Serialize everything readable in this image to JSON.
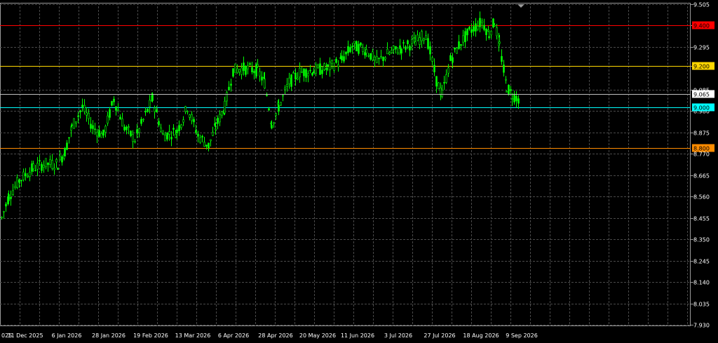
{
  "window": {
    "scroll_marker_icon": "triangle-down-icon"
  },
  "chart_data": {
    "type": "candlestick",
    "grid": true,
    "background": "#000000",
    "grid_color": "#4a4a4a",
    "bull_color": "#00ff00",
    "bear_color": "#00ff00",
    "ylim": [
      7.93,
      9.505
    ],
    "y_ticks": [
      "9.505",
      "9.400",
      "9.295",
      "9.200",
      "9.085",
      "8.980",
      "8.875",
      "8.770",
      "8.665",
      "8.560",
      "8.455",
      "8.350",
      "8.245",
      "8.140",
      "8.035",
      "7.930"
    ],
    "x_labels": [
      "025",
      "11 Dec 2025",
      "6 Jan 2026",
      "28 Jan 2026",
      "19 Feb 2026",
      "13 Mar 2026",
      "6 Apr 2026",
      "28 Apr 2026",
      "20 May 2026",
      "11 Jun 2026",
      "3 Jul 2026",
      "27 Jul 2026",
      "18 Aug 2026",
      "9 Sep 2026"
    ],
    "levels": [
      {
        "label": "9.400",
        "value": 9.4,
        "color": "#ff0000",
        "label_bg": "#ff0000",
        "label_color": "#000000"
      },
      {
        "label": "9.200",
        "value": 9.2,
        "color": "#ffd700",
        "label_bg": "#ffd700",
        "label_color": "#000000"
      },
      {
        "label": "9.000",
        "value": 9.0,
        "color": "#00ffff",
        "label_bg": "#00ffff",
        "label_color": "#000000"
      },
      {
        "label": "8.800",
        "value": 8.8,
        "color": "#ff8c00",
        "label_bg": "#ff8c00",
        "label_color": "#000000"
      }
    ],
    "current_price": {
      "label": "9.065",
      "value": 9.065,
      "line_color": "#c0c0c0",
      "label_bg": "#ffffff",
      "label_color": "#000000"
    },
    "path_points": [
      [
        8.455,
        0
      ],
      [
        8.56,
        10
      ],
      [
        8.64,
        25
      ],
      [
        8.7,
        45
      ],
      [
        8.72,
        60
      ],
      [
        8.72,
        80
      ],
      [
        8.78,
        90
      ],
      [
        8.9,
        100
      ],
      [
        9.0,
        115
      ],
      [
        8.9,
        130
      ],
      [
        8.86,
        145
      ],
      [
        9.04,
        160
      ],
      [
        8.9,
        175
      ],
      [
        8.84,
        190
      ],
      [
        8.96,
        205
      ],
      [
        9.04,
        215
      ],
      [
        8.86,
        230
      ],
      [
        8.88,
        250
      ],
      [
        9.0,
        265
      ],
      [
        8.86,
        280
      ],
      [
        8.81,
        295
      ],
      [
        8.9,
        305
      ],
      [
        9.0,
        318
      ],
      [
        9.18,
        330
      ],
      [
        9.19,
        345
      ],
      [
        9.18,
        365
      ],
      [
        9.12,
        375
      ],
      [
        8.92,
        385
      ],
      [
        9.0,
        395
      ],
      [
        9.12,
        410
      ],
      [
        9.17,
        425
      ],
      [
        9.18,
        445
      ],
      [
        9.19,
        465
      ],
      [
        9.23,
        485
      ],
      [
        9.3,
        500
      ],
      [
        9.28,
        520
      ],
      [
        9.22,
        535
      ],
      [
        9.26,
        550
      ],
      [
        9.29,
        570
      ],
      [
        9.32,
        590
      ],
      [
        9.36,
        605
      ],
      [
        9.13,
        620
      ],
      [
        9.06,
        628
      ],
      [
        9.23,
        640
      ],
      [
        9.32,
        655
      ],
      [
        9.38,
        670
      ],
      [
        9.42,
        685
      ],
      [
        9.36,
        695
      ],
      [
        9.42,
        703
      ],
      [
        9.3,
        710
      ],
      [
        9.1,
        720
      ],
      [
        9.06,
        728
      ],
      [
        9.04,
        738
      ]
    ]
  }
}
